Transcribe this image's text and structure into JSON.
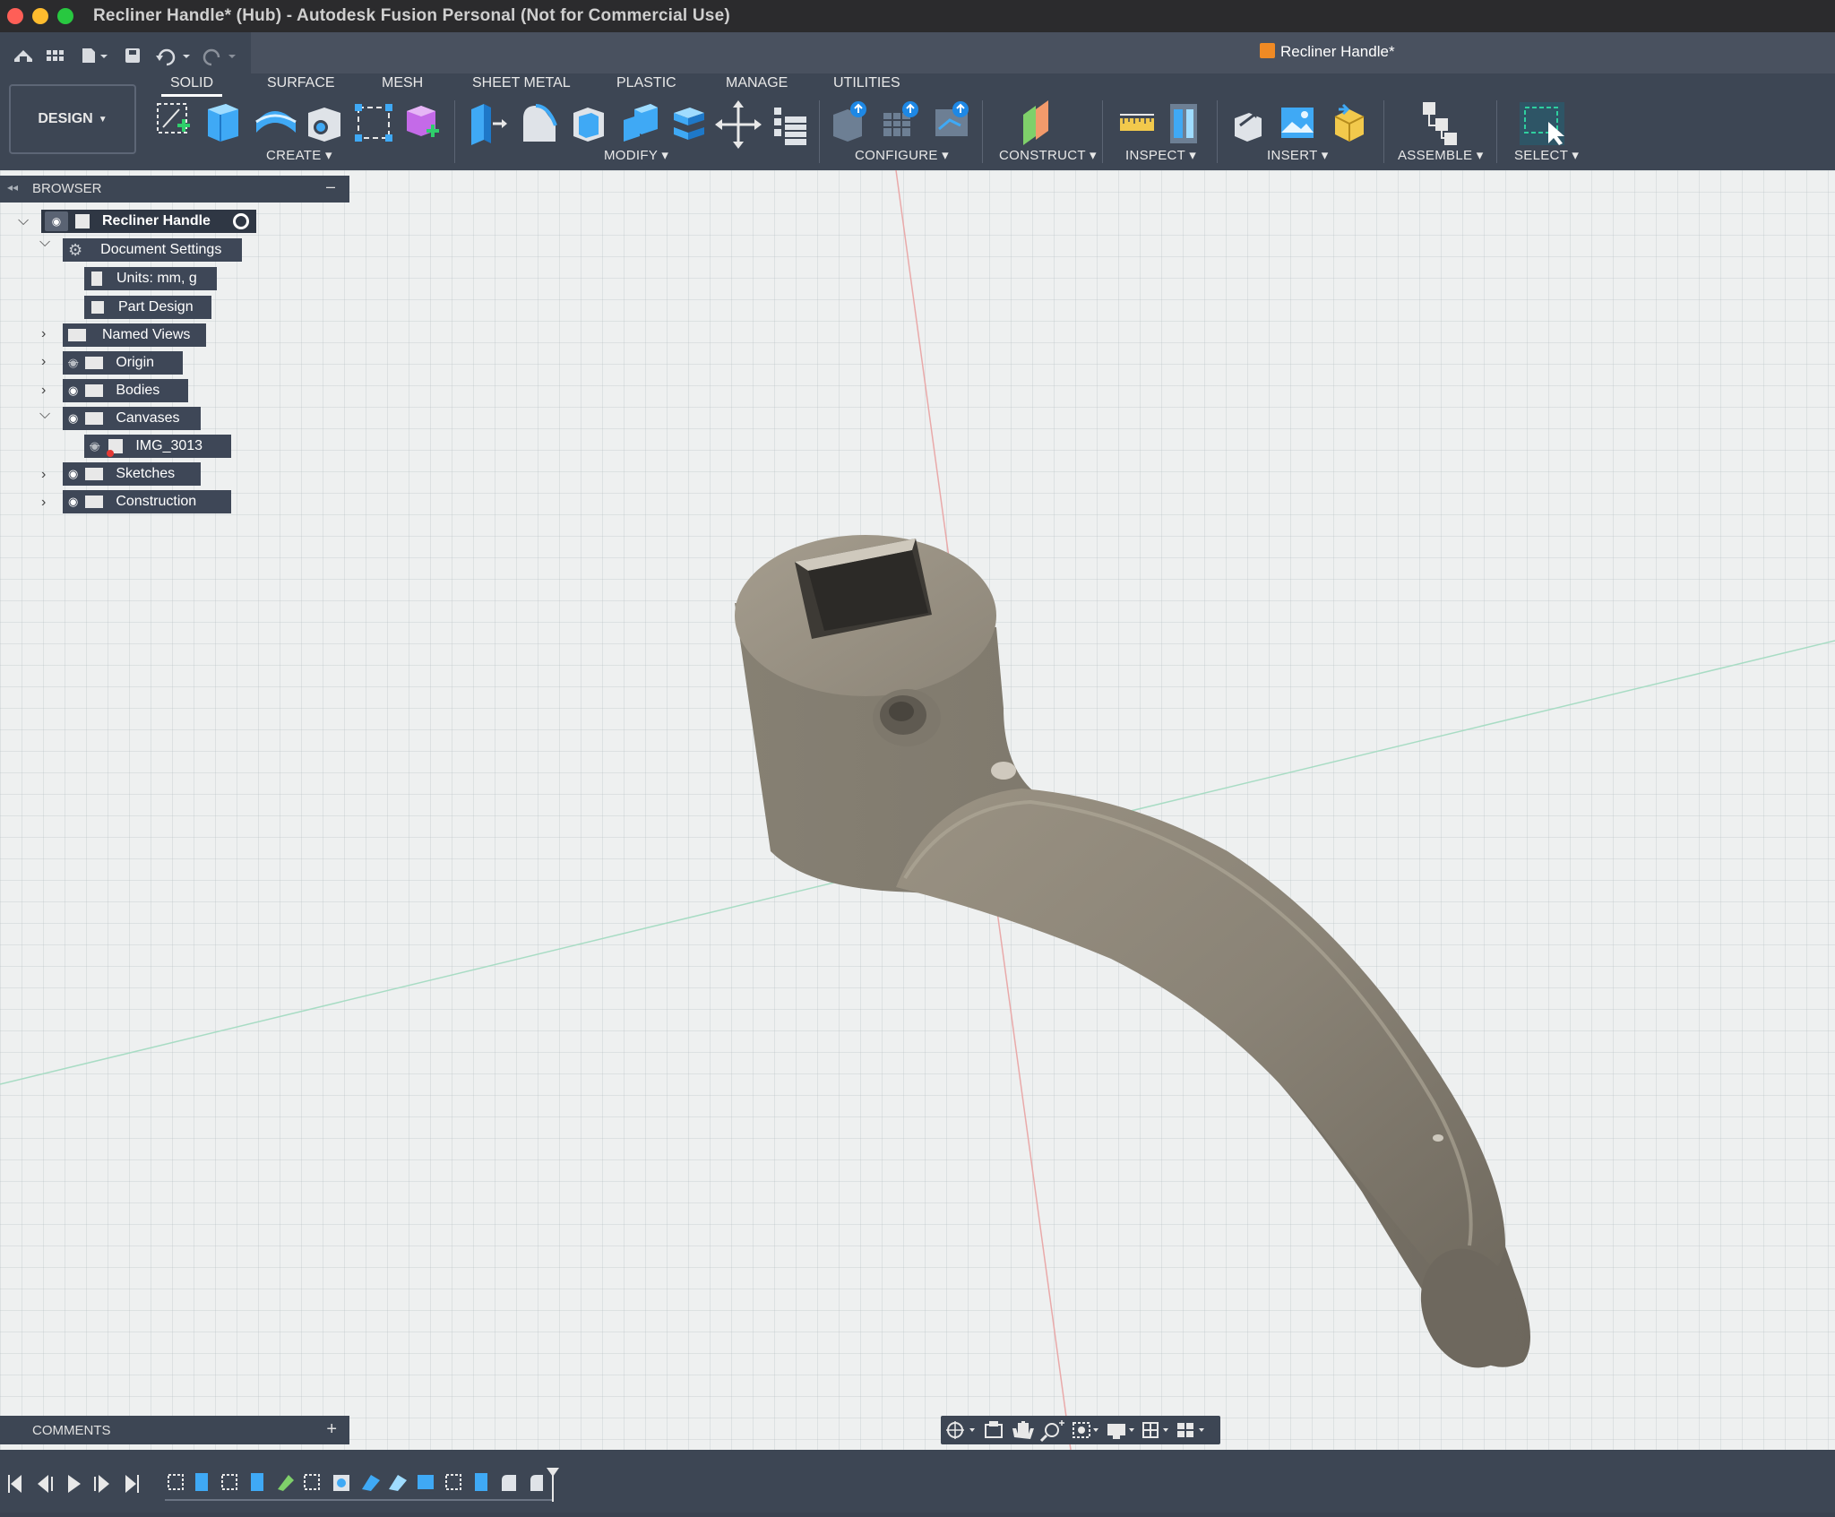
{
  "window": {
    "title": "Recliner Handle* (Hub) - Autodesk Fusion Personal (Not for Commercial Use)",
    "traffic_colors": [
      "#fe5f57",
      "#febc2e",
      "#28c840"
    ]
  },
  "document_tab": {
    "label": "Recliner Handle*",
    "icon": "part-cube-icon"
  },
  "workspace": {
    "label": "DESIGN"
  },
  "ribbon": {
    "tabs": [
      "SOLID",
      "SURFACE",
      "MESH",
      "SHEET METAL",
      "PLASTIC",
      "MANAGE",
      "UTILITIES"
    ],
    "active_tab": "SOLID",
    "groups": [
      "CREATE",
      "MODIFY",
      "CONFIGURE",
      "CONSTRUCT",
      "INSPECT",
      "INSERT",
      "ASSEMBLE",
      "SELECT"
    ]
  },
  "browser": {
    "title": "BROWSER",
    "items": [
      {
        "label": "Recliner Handle",
        "icon": "component-icon",
        "expanded": true
      },
      {
        "label": "Document Settings",
        "icon": "gear-icon",
        "expanded": true
      },
      {
        "label": "Units: mm, g",
        "icon": "document-icon"
      },
      {
        "label": "Part Design",
        "icon": "part-cube-icon"
      },
      {
        "label": "Named Views",
        "icon": "folder-icon",
        "expanded": false
      },
      {
        "label": "Origin",
        "icon": "folder-icon",
        "visible": false
      },
      {
        "label": "Bodies",
        "icon": "folder-icon",
        "visible": true
      },
      {
        "label": "Canvases",
        "icon": "folder-icon",
        "visible": true,
        "expanded": true
      },
      {
        "label": "IMG_3013",
        "icon": "canvas-image-icon",
        "visible": false
      },
      {
        "label": "Sketches",
        "icon": "folder-icon",
        "visible": true
      },
      {
        "label": "Construction",
        "icon": "folder-icon",
        "visible": true
      }
    ]
  },
  "comments": {
    "title": "COMMENTS"
  },
  "colors": {
    "accent": "#3d4654",
    "model": "#8e877b",
    "viewport": "#eef0f0"
  }
}
